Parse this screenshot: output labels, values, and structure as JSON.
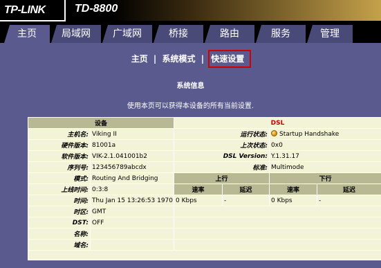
{
  "brand": {
    "logo": "TP-LINK",
    "model": "TD-8800"
  },
  "tabs": [
    "主页",
    "局域网",
    "广域网",
    "桥接",
    "路由",
    "服务",
    "管理"
  ],
  "subnav": {
    "item1": "主页",
    "item2": "系统模式",
    "item3": "快速设置",
    "sep": "|"
  },
  "info": {
    "title": "系统信息",
    "desc": "使用本页可以获得本设备的所有当前设置."
  },
  "table": {
    "device_header": "设备",
    "dsl_header": "DSL",
    "left": [
      {
        "label": "主机名:",
        "value": "Viking II"
      },
      {
        "label": "硬件版本:",
        "value": "81001a"
      },
      {
        "label": "软件版本:",
        "value": "VIK-2.1.041001b2"
      },
      {
        "label": "序列号:",
        "value": "123456789abcdx"
      },
      {
        "label": "模式:",
        "value": "Routing And Bridging"
      },
      {
        "label": "上线时间:",
        "value": "0:3:8"
      },
      {
        "label": "时间:",
        "value": "Thu Jan 15 13:26:53 1970"
      },
      {
        "label": "时区:",
        "value": "GMT"
      },
      {
        "label": "DST:",
        "value": "OFF"
      },
      {
        "label": "名称:",
        "value": ""
      },
      {
        "label": "域名:",
        "value": ""
      }
    ],
    "dsl": {
      "status_label": "运行状态:",
      "status_value": "Startup Handshake",
      "last_label": "上次状态:",
      "last_value": "0x0",
      "version_label": "DSL Version:",
      "version_value": "Y.1.31.17",
      "standard_label": "标准:",
      "standard_value": "Multimode",
      "upstream": "上行",
      "downstream": "下行",
      "rate": "速率",
      "latency": "延迟",
      "up_rate": "0 Kbps",
      "up_latency": "-",
      "down_rate": "0 Kbps",
      "down_latency": "-"
    }
  }
}
